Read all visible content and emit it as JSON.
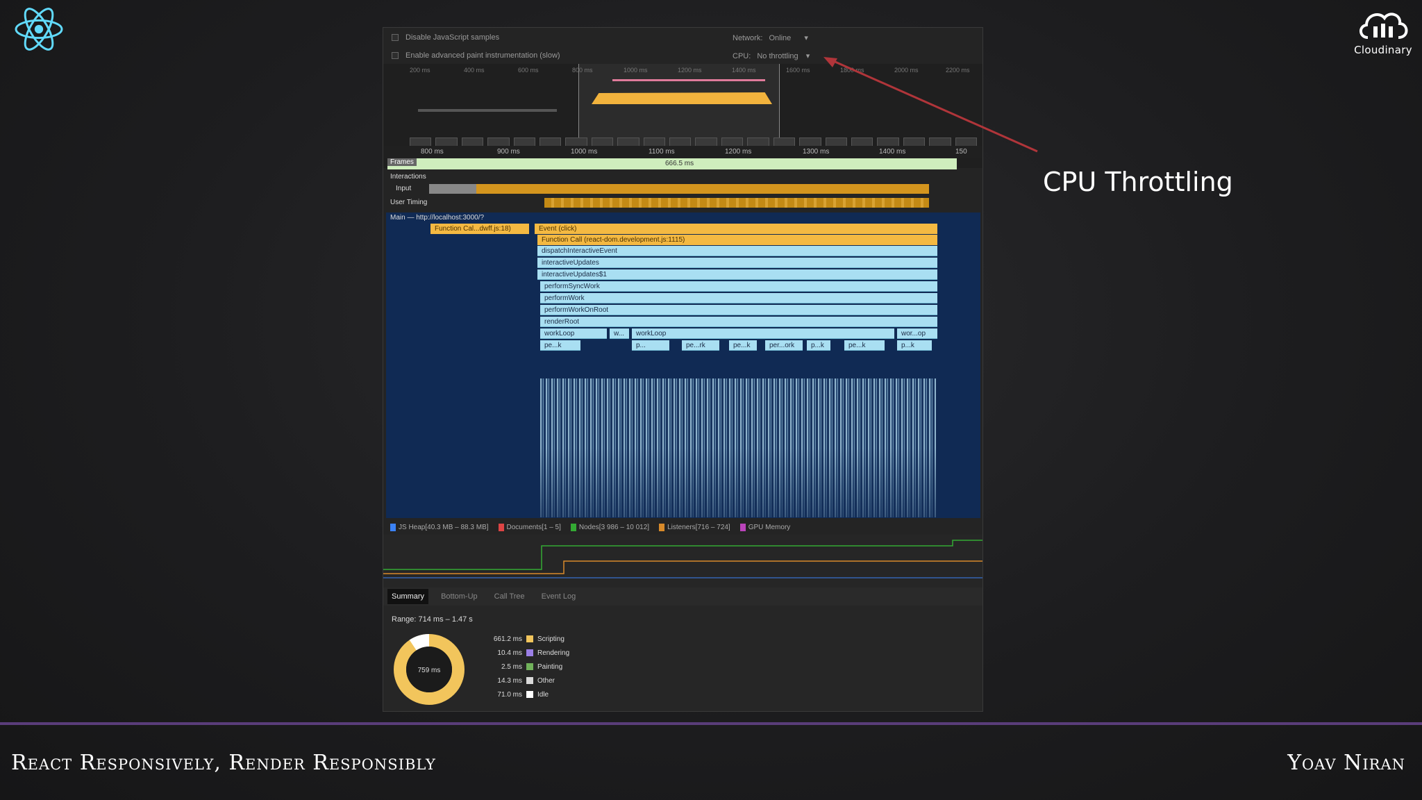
{
  "slide": {
    "footer_title": "React Responsively, Render Responsibly",
    "footer_author": "Yoav Niran",
    "annotation": "CPU Throttling",
    "cloud_logo_text": "Cloudinary"
  },
  "devtools": {
    "settings": {
      "disable_js_samples": "Disable JavaScript samples",
      "advanced_paint": "Enable advanced paint instrumentation (slow)",
      "network_label": "Network:",
      "network_value": "Online",
      "cpu_label": "CPU:",
      "cpu_value": "No throttling"
    },
    "overview_ticks": [
      "200 ms",
      "400 ms",
      "600 ms",
      "800 ms",
      "1000 ms",
      "1200 ms",
      "1400 ms",
      "1600 ms",
      "1800 ms",
      "2000 ms",
      "2200 ms"
    ],
    "ruler_ticks": [
      "800 ms",
      "900 ms",
      "1000 ms",
      "1100 ms",
      "1200 ms",
      "1300 ms",
      "1400 ms",
      "150"
    ],
    "frames_label": "Frames",
    "frames_value": "666.5 ms",
    "tracks": {
      "interactions": "Interactions",
      "input": "Input",
      "user_timing": "User Timing",
      "main": "Main — http://localhost:3000/?"
    },
    "flame": {
      "function_call_left": "Function Cal...dwff.js:18)",
      "event": "Event (click)",
      "function_call": "Function Call (react-dom.development.js:1115)",
      "rows": [
        "dispatchInteractiveEvent",
        "interactiveUpdates",
        "interactiveUpdates$1",
        "performSyncWork",
        "performWork",
        "performWorkOnRoot",
        "renderRoot"
      ],
      "workloop_a": "workLoop",
      "workloop_w": "w...",
      "workloop_b": "workLoop",
      "workloop_c": "wor...op",
      "leaves": [
        "pe...k",
        "p...",
        "pe...rk",
        "pe...k",
        "per...ork",
        "p...k",
        "pe...k",
        "p...k"
      ]
    },
    "memory_legend": [
      "JS Heap[40.3 MB – 88.3 MB]",
      "Documents[1 – 5]",
      "Nodes[3 986 – 10 012]",
      "Listeners[716 – 724]",
      "GPU Memory"
    ],
    "tabs": [
      "Summary",
      "Bottom-Up",
      "Call Tree",
      "Event Log"
    ],
    "range": "Range: 714 ms – 1.47 s",
    "donut_center": "759 ms",
    "summary": [
      {
        "value": "661.2 ms",
        "label": "Scripting",
        "color": "#f2c55c"
      },
      {
        "value": "10.4 ms",
        "label": "Rendering",
        "color": "#9b7fe6"
      },
      {
        "value": "2.5 ms",
        "label": "Painting",
        "color": "#71b25b"
      },
      {
        "value": "14.3 ms",
        "label": "Other",
        "color": "#dadada"
      },
      {
        "value": "71.0 ms",
        "label": "Idle",
        "color": "#ffffff"
      }
    ]
  }
}
